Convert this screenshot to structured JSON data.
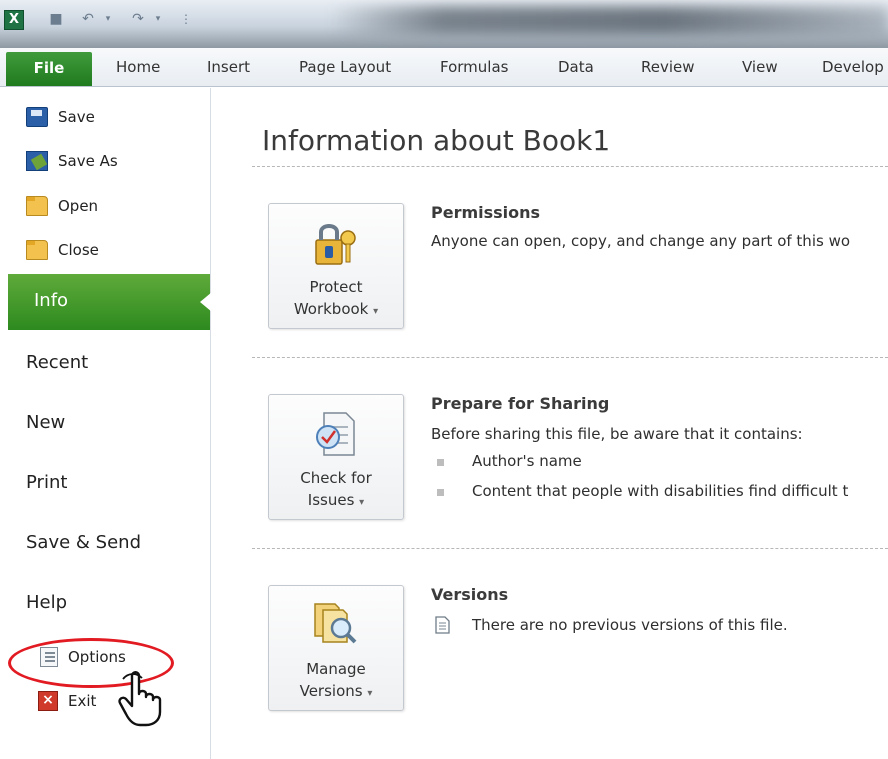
{
  "tabs": {
    "file": "File",
    "items": [
      "Home",
      "Insert",
      "Page Layout",
      "Formulas",
      "Data",
      "Review",
      "View",
      "Develop"
    ]
  },
  "sidebar": {
    "commands": [
      {
        "label": "Save",
        "icon": "save-icon"
      },
      {
        "label": "Save As",
        "icon": "save-as-icon"
      },
      {
        "label": "Open",
        "icon": "open-folder-icon"
      },
      {
        "label": "Close",
        "icon": "close-folder-icon"
      }
    ],
    "info": "Info",
    "nav": [
      "Recent",
      "New",
      "Print",
      "Save & Send",
      "Help"
    ],
    "options": "Options",
    "exit": "Exit"
  },
  "main": {
    "title": "Information about Book1",
    "permissions": {
      "button_line1": "Protect",
      "button_line2": "Workbook",
      "heading": "Permissions",
      "text": "Anyone can open, copy, and change any part of this wo"
    },
    "sharing": {
      "button_line1": "Check for",
      "button_line2": "Issues",
      "heading": "Prepare for Sharing",
      "text": "Before sharing this file, be aware that it contains:",
      "bullets": [
        "Author's name",
        "Content that people with disabilities find difficult t"
      ]
    },
    "versions": {
      "button_line1": "Manage",
      "button_line2": "Versions",
      "heading": "Versions",
      "text": "There are no previous versions of this file."
    }
  },
  "colors": {
    "file_tab": "#2d8a1f",
    "highlight_oval": "#e21a22"
  }
}
